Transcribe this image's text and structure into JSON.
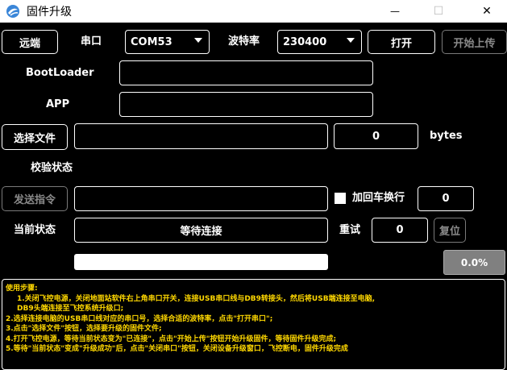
{
  "window": {
    "title": "固件升级",
    "minimize_glyph": "—",
    "maximize_glyph": "☐",
    "close_glyph": "✕"
  },
  "toolbar": {
    "remote_label": "远端",
    "port_label": "串口",
    "port_value": "COM53",
    "baud_label": "波特率",
    "baud_value": "230400",
    "open_label": "打开",
    "start_upload_label": "开始上传"
  },
  "fields": {
    "bootloader_label": "BootLoader",
    "bootloader_value": "",
    "app_label": "APP",
    "app_value": "",
    "select_file_label": "选择文件",
    "file_path": "",
    "file_size": "0",
    "bytes_label": "bytes",
    "verify_label": "校验状态"
  },
  "command": {
    "send_label": "发送指令",
    "command_value": "",
    "crlf_label": "加回车换行",
    "crlf_checked": false,
    "count_value": "0"
  },
  "status": {
    "current_label": "当前状态",
    "current_value": "等待连接",
    "retry_label": "重试",
    "retry_value": "0",
    "reset_label": "复位",
    "progress_percent": 0,
    "progress_text": "0.0%"
  },
  "instructions": {
    "title": "使用步骤:",
    "lines": [
      "1.关闭飞控电源，关闭地面站软件右上角串口开关，连接USB串口线与DB9转接头，然后将USB端连接至电脑,",
      "DB9头端连接至飞控系统升级口;",
      "2.选择连接电脑的USB串口线对应的串口号，选择合适的波特率，点击\"打开串口\";",
      "3.点击\"选择文件\"按钮，选择要升级的固件文件;",
      "4.打开飞控电源，等待当前状态变为\"已连接\"，点击\"开始上传\"按钮开始升级固件，等待固件升级完成;",
      "5.等待\"当前状态\"变成\"升级成功\"后，点击\"关闭串口\"按钮，关闭设备升级窗口，飞控断电，固件升级完成"
    ]
  }
}
